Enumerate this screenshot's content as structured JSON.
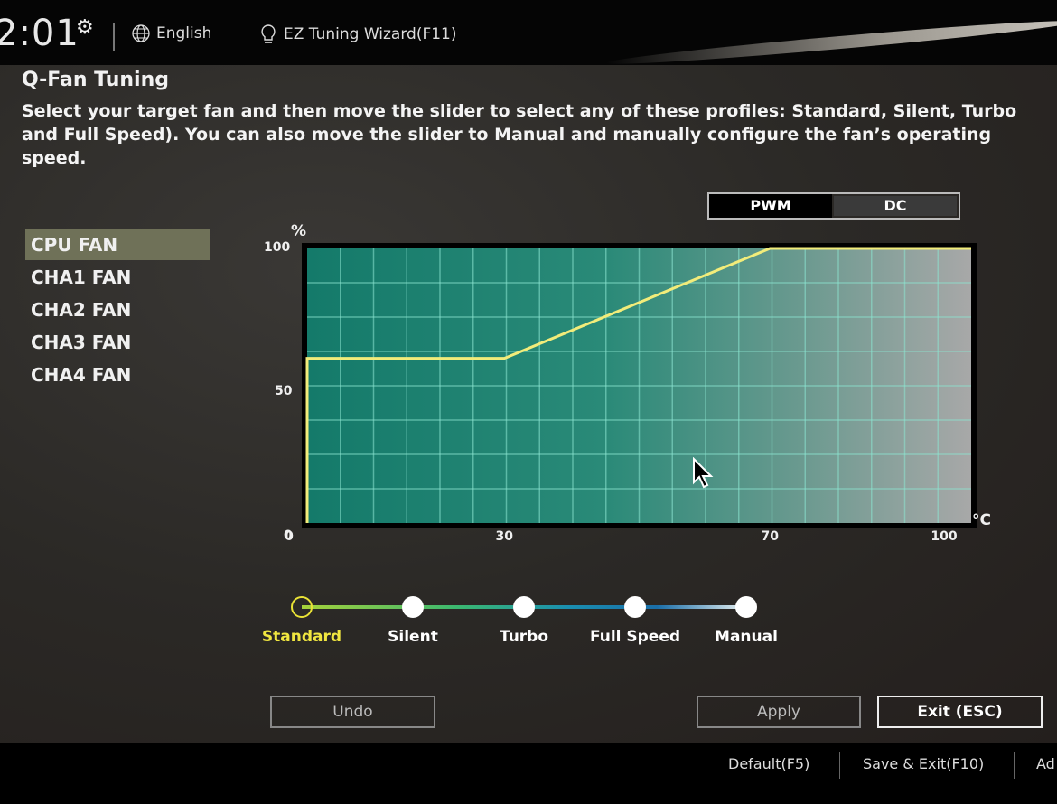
{
  "header": {
    "time": "2:01",
    "settings_icon": "gear-icon",
    "language_icon": "globe-icon",
    "language": "English",
    "wizard_icon": "lightbulb-icon",
    "wizard": "EZ Tuning Wizard(F11)"
  },
  "page": {
    "title": "Q-Fan Tuning",
    "description": "Select your target fan and then move the slider to select any of these profiles: Standard, Silent, Turbo and Full Speed). You can also move the slider to Manual and manually configure the fan’s operating speed."
  },
  "fans": [
    {
      "label": "CPU FAN",
      "selected": true
    },
    {
      "label": "CHA1 FAN",
      "selected": false
    },
    {
      "label": "CHA2 FAN",
      "selected": false
    },
    {
      "label": "CHA3 FAN",
      "selected": false
    },
    {
      "label": "CHA4 FAN",
      "selected": false
    }
  ],
  "mode": {
    "options": [
      "PWM",
      "DC"
    ],
    "selected": "PWM"
  },
  "chart_data": {
    "type": "line",
    "title": "",
    "xlabel": "°C",
    "ylabel": "%",
    "x_ticks": [
      "0",
      "30",
      "70",
      "100"
    ],
    "y_ticks": [
      "100",
      "50",
      "0"
    ],
    "xlim": [
      0,
      100
    ],
    "ylim": [
      0,
      100
    ],
    "grid": true,
    "series": [
      {
        "name": "CPU FAN curve",
        "x": [
          0,
          0,
          30,
          70,
          100
        ],
        "y": [
          0,
          60,
          60,
          100,
          100
        ]
      }
    ],
    "line_color": "#f2ec7a"
  },
  "profiles": {
    "options": [
      "Standard",
      "Silent",
      "Turbo",
      "Full Speed",
      "Manual"
    ],
    "selected": "Standard",
    "active_color": "#f0e640"
  },
  "buttons": {
    "undo": "Undo",
    "apply": "Apply",
    "exit": "Exit (ESC)"
  },
  "footer": {
    "default": "Default(F5)",
    "save_exit": "Save & Exit(F10)",
    "advanced": "Ad"
  }
}
